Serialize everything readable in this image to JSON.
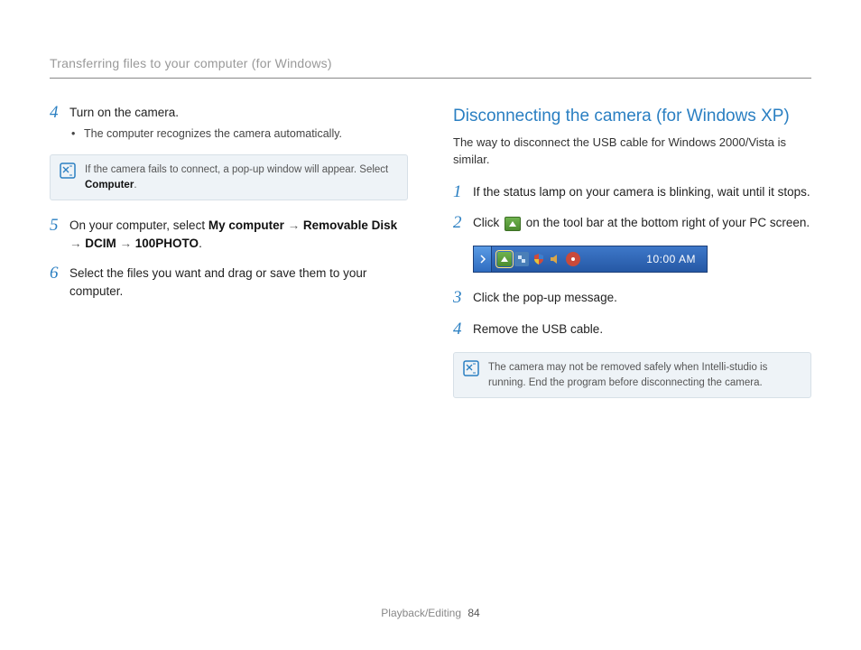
{
  "header": {
    "title": "Transferring files to your computer (for Windows)"
  },
  "left": {
    "step4": {
      "num": "4",
      "main": "Turn on the camera.",
      "bullet_dot": "•",
      "bullet": "The computer recognizes the camera automatically.",
      "note_pre": "If the camera fails to connect, a pop-up window will appear. Select ",
      "note_bold": "Computer",
      "note_post": "."
    },
    "step5": {
      "num": "5",
      "pre": "On your computer, select ",
      "b1": "My computer",
      "arr": " → ",
      "b2": "Removable Disk",
      "b3": "DCIM",
      "b4": "100PHOTO",
      "post": "."
    },
    "step6": {
      "num": "6",
      "main": "Select the files you want and drag or save them to your computer."
    }
  },
  "right": {
    "heading": "Disconnecting the camera (for Windows XP)",
    "intro": "The way to disconnect the USB cable for Windows 2000/Vista is similar.",
    "step1": {
      "num": "1",
      "main": "If the status lamp on your camera is blinking, wait until it stops."
    },
    "step2": {
      "num": "2",
      "pre": "Click ",
      "post": " on the tool bar at the bottom right of your PC screen."
    },
    "taskbar": {
      "time": "10:00 AM"
    },
    "step3": {
      "num": "3",
      "main": "Click the pop-up message."
    },
    "step4": {
      "num": "4",
      "main": "Remove the USB cable."
    },
    "note": "The camera may not be removed safely when Intelli-studio is running. End the program before disconnecting the camera."
  },
  "footer": {
    "section": "Playback/Editing",
    "page": "84"
  }
}
